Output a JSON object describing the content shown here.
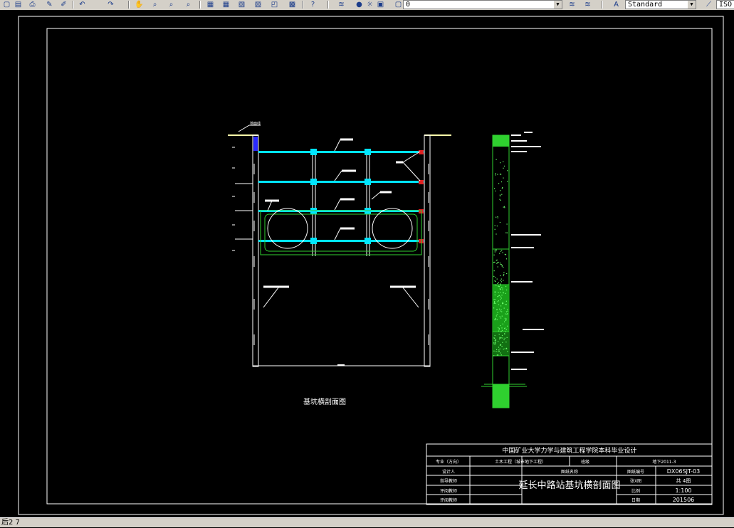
{
  "toolbar": {
    "layer_value": "0",
    "text_style_value": "Standard",
    "dimstyle_value": "ISO",
    "buttons": [
      "save-icon",
      "open-icon",
      "print-icon",
      "pencil-icon",
      "brush-icon",
      "undo-icon",
      "redo-icon",
      "pan-icon",
      "zoom-realtime-icon",
      "zoom-window-icon",
      "zoom-previous-icon",
      "properties-icon",
      "design-center-icon",
      "tool-palettes-icon",
      "sheet-set-icon",
      "markup-icon",
      "calculator-icon",
      "help-icon",
      "layer-manager-icon",
      "lightbulb-icon",
      "sun-icon",
      "lock-icon",
      "layer-state-icon"
    ]
  },
  "drawing": {
    "top_label": "地面线",
    "section_title": "基坑横剖面图",
    "title_block": {
      "header": "中国矿业大学力学与建筑工程学院本科毕业设计",
      "row1": [
        "专业（方向）",
        "土木工程（城市地下工程）",
        "班级",
        "地下2011-3"
      ],
      "drawing_name_label": "图纸名称",
      "drawing_name": "延长中路站基坑横剖面图",
      "roles": [
        "设计人",
        "指导教师",
        "评阅教师",
        "评阅教师"
      ],
      "info_labels": [
        "图纸编号",
        "张X图",
        "比例",
        "日期"
      ],
      "info_values": [
        "DX06SJT-03",
        "共 4图",
        "1:100",
        "201506"
      ]
    }
  },
  "status": {
    "left_text": "后2 7"
  }
}
